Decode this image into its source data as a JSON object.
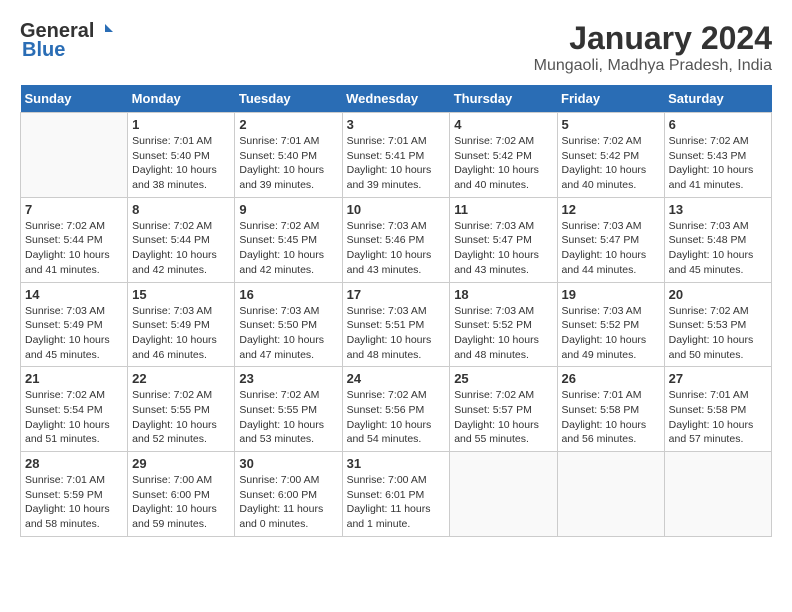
{
  "logo": {
    "general": "General",
    "blue": "Blue"
  },
  "title": "January 2024",
  "subtitle": "Mungaoli, Madhya Pradesh, India",
  "days_of_week": [
    "Sunday",
    "Monday",
    "Tuesday",
    "Wednesday",
    "Thursday",
    "Friday",
    "Saturday"
  ],
  "weeks": [
    [
      {
        "day": "",
        "info": ""
      },
      {
        "day": "1",
        "info": "Sunrise: 7:01 AM\nSunset: 5:40 PM\nDaylight: 10 hours\nand 38 minutes."
      },
      {
        "day": "2",
        "info": "Sunrise: 7:01 AM\nSunset: 5:40 PM\nDaylight: 10 hours\nand 39 minutes."
      },
      {
        "day": "3",
        "info": "Sunrise: 7:01 AM\nSunset: 5:41 PM\nDaylight: 10 hours\nand 39 minutes."
      },
      {
        "day": "4",
        "info": "Sunrise: 7:02 AM\nSunset: 5:42 PM\nDaylight: 10 hours\nand 40 minutes."
      },
      {
        "day": "5",
        "info": "Sunrise: 7:02 AM\nSunset: 5:42 PM\nDaylight: 10 hours\nand 40 minutes."
      },
      {
        "day": "6",
        "info": "Sunrise: 7:02 AM\nSunset: 5:43 PM\nDaylight: 10 hours\nand 41 minutes."
      }
    ],
    [
      {
        "day": "7",
        "info": "Sunrise: 7:02 AM\nSunset: 5:44 PM\nDaylight: 10 hours\nand 41 minutes."
      },
      {
        "day": "8",
        "info": "Sunrise: 7:02 AM\nSunset: 5:44 PM\nDaylight: 10 hours\nand 42 minutes."
      },
      {
        "day": "9",
        "info": "Sunrise: 7:02 AM\nSunset: 5:45 PM\nDaylight: 10 hours\nand 42 minutes."
      },
      {
        "day": "10",
        "info": "Sunrise: 7:03 AM\nSunset: 5:46 PM\nDaylight: 10 hours\nand 43 minutes."
      },
      {
        "day": "11",
        "info": "Sunrise: 7:03 AM\nSunset: 5:47 PM\nDaylight: 10 hours\nand 43 minutes."
      },
      {
        "day": "12",
        "info": "Sunrise: 7:03 AM\nSunset: 5:47 PM\nDaylight: 10 hours\nand 44 minutes."
      },
      {
        "day": "13",
        "info": "Sunrise: 7:03 AM\nSunset: 5:48 PM\nDaylight: 10 hours\nand 45 minutes."
      }
    ],
    [
      {
        "day": "14",
        "info": "Sunrise: 7:03 AM\nSunset: 5:49 PM\nDaylight: 10 hours\nand 45 minutes."
      },
      {
        "day": "15",
        "info": "Sunrise: 7:03 AM\nSunset: 5:49 PM\nDaylight: 10 hours\nand 46 minutes."
      },
      {
        "day": "16",
        "info": "Sunrise: 7:03 AM\nSunset: 5:50 PM\nDaylight: 10 hours\nand 47 minutes."
      },
      {
        "day": "17",
        "info": "Sunrise: 7:03 AM\nSunset: 5:51 PM\nDaylight: 10 hours\nand 48 minutes."
      },
      {
        "day": "18",
        "info": "Sunrise: 7:03 AM\nSunset: 5:52 PM\nDaylight: 10 hours\nand 48 minutes."
      },
      {
        "day": "19",
        "info": "Sunrise: 7:03 AM\nSunset: 5:52 PM\nDaylight: 10 hours\nand 49 minutes."
      },
      {
        "day": "20",
        "info": "Sunrise: 7:02 AM\nSunset: 5:53 PM\nDaylight: 10 hours\nand 50 minutes."
      }
    ],
    [
      {
        "day": "21",
        "info": "Sunrise: 7:02 AM\nSunset: 5:54 PM\nDaylight: 10 hours\nand 51 minutes."
      },
      {
        "day": "22",
        "info": "Sunrise: 7:02 AM\nSunset: 5:55 PM\nDaylight: 10 hours\nand 52 minutes."
      },
      {
        "day": "23",
        "info": "Sunrise: 7:02 AM\nSunset: 5:55 PM\nDaylight: 10 hours\nand 53 minutes."
      },
      {
        "day": "24",
        "info": "Sunrise: 7:02 AM\nSunset: 5:56 PM\nDaylight: 10 hours\nand 54 minutes."
      },
      {
        "day": "25",
        "info": "Sunrise: 7:02 AM\nSunset: 5:57 PM\nDaylight: 10 hours\nand 55 minutes."
      },
      {
        "day": "26",
        "info": "Sunrise: 7:01 AM\nSunset: 5:58 PM\nDaylight: 10 hours\nand 56 minutes."
      },
      {
        "day": "27",
        "info": "Sunrise: 7:01 AM\nSunset: 5:58 PM\nDaylight: 10 hours\nand 57 minutes."
      }
    ],
    [
      {
        "day": "28",
        "info": "Sunrise: 7:01 AM\nSunset: 5:59 PM\nDaylight: 10 hours\nand 58 minutes."
      },
      {
        "day": "29",
        "info": "Sunrise: 7:00 AM\nSunset: 6:00 PM\nDaylight: 10 hours\nand 59 minutes."
      },
      {
        "day": "30",
        "info": "Sunrise: 7:00 AM\nSunset: 6:00 PM\nDaylight: 11 hours\nand 0 minutes."
      },
      {
        "day": "31",
        "info": "Sunrise: 7:00 AM\nSunset: 6:01 PM\nDaylight: 11 hours\nand 1 minute."
      },
      {
        "day": "",
        "info": ""
      },
      {
        "day": "",
        "info": ""
      },
      {
        "day": "",
        "info": ""
      }
    ]
  ]
}
